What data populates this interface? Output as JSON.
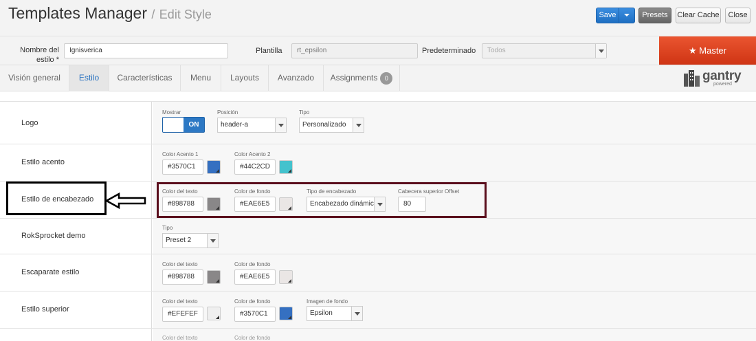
{
  "header": {
    "title": "Templates Manager",
    "separator": "/",
    "subtitle": "Edit Style",
    "buttons": {
      "save": "Save",
      "presets": "Presets",
      "clear_cache": "Clear Cache",
      "close": "Close"
    }
  },
  "fields": {
    "style_name_label": "Nombre del estilo *",
    "style_name_value": "Ignisverica",
    "template_label": "Plantilla",
    "template_value": "rt_epsilon",
    "default_label": "Predeterminado",
    "default_value": "Todos",
    "master_label": "★ Master"
  },
  "tabs": [
    {
      "label": "Visión general"
    },
    {
      "label": "Estilo"
    },
    {
      "label": "Características"
    },
    {
      "label": "Menu"
    },
    {
      "label": "Layouts"
    },
    {
      "label": "Avanzado"
    },
    {
      "label": "Assignments",
      "badge": "0"
    }
  ],
  "brand": {
    "word": "gantry",
    "sub": "powered"
  },
  "rows": {
    "logo": {
      "label": "Logo",
      "mostrar_label": "Mostrar",
      "toggle_value": "ON",
      "posicion_label": "Posición",
      "posicion_value": "header-a",
      "tipo_label": "Tipo",
      "tipo_value": "Personalizado"
    },
    "acento": {
      "label": "Estilo acento",
      "c1_label": "Color Acento 1",
      "c1_value": "#3570C1",
      "c2_label": "Color Acento 2",
      "c2_value": "#44C2CD"
    },
    "encabezado": {
      "label": "Estilo de encabezado",
      "texto_label": "Color del texto",
      "texto_value": "#898788",
      "fondo_label": "Color de fondo",
      "fondo_value": "#EAE6E5",
      "tipo_label": "Tipo de encabezado",
      "tipo_value": "Encabezado dinámico",
      "offset_label": "Cabecera superior Offset",
      "offset_value": "80"
    },
    "roksprocket": {
      "label": "RokSprocket demo",
      "tipo_label": "Tipo",
      "tipo_value": "Preset 2"
    },
    "escaparate": {
      "label": "Escaparate estilo",
      "texto_label": "Color del texto",
      "texto_value": "#898788",
      "fondo_label": "Color de fondo",
      "fondo_value": "#EAE6E5"
    },
    "superior": {
      "label": "Estilo superior",
      "texto_label": "Color del texto",
      "texto_value": "#EFEFEF",
      "fondo_label": "Color de fondo",
      "fondo_value": "#3570C1",
      "imagen_label": "Imagen de fondo",
      "imagen_value": "Epsilon"
    },
    "next": {
      "texto_label": "Color del texto",
      "fondo_label": "Color de fondo"
    }
  },
  "colors": {
    "accent1": "#3570C1",
    "accent2": "#44C2CD",
    "header_text": "#898788",
    "header_bg": "#EAE6E5",
    "top_text": "#EFEFEF",
    "top_bg": "#3570C1",
    "master": "#e04420",
    "highlight_border": "#5a0e1c"
  }
}
